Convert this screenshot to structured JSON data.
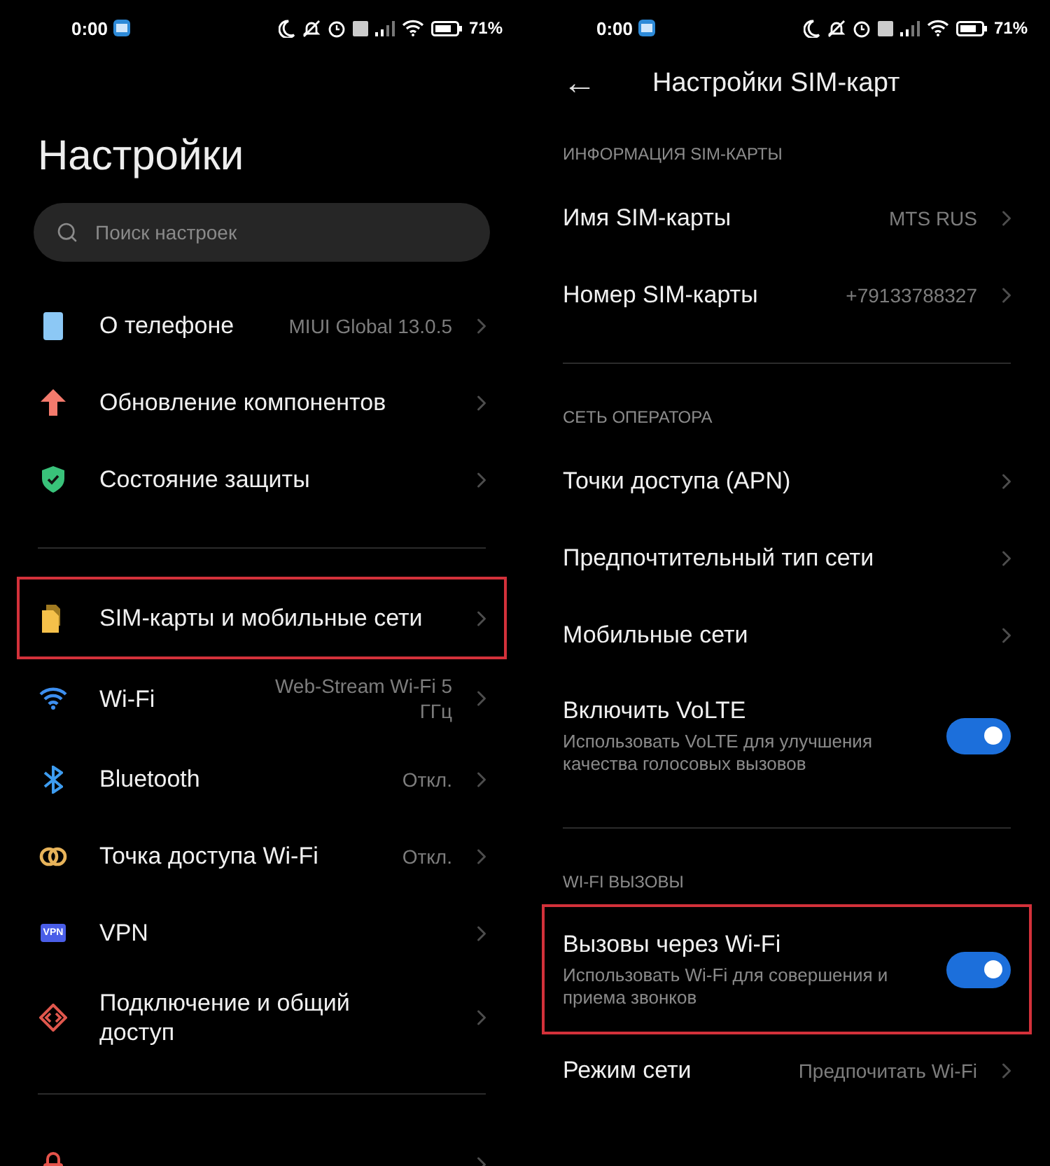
{
  "left_screen": {
    "status_bar": {
      "time": "0:00",
      "battery": "71%"
    },
    "title": "Настройки",
    "search": {
      "placeholder": "Поиск настроек"
    },
    "groups": [
      {
        "items": [
          {
            "kind": "phone",
            "label": "О телефоне",
            "value": "MIUI Global 13.0.5",
            "highlighted": false
          },
          {
            "kind": "update",
            "label": "Обновление компонентов",
            "highlighted": false
          },
          {
            "kind": "shield",
            "label": "Состояние защиты",
            "highlighted": false
          }
        ]
      },
      {
        "items": [
          {
            "kind": "sim",
            "label": "SIM-карты и мобильные сети",
            "highlighted": true
          },
          {
            "kind": "wifi",
            "label": "Wi-Fi",
            "value": "Web-Stream Wi-Fi 5 ГГц",
            "highlighted": false
          },
          {
            "kind": "bluetooth",
            "label": "Bluetooth",
            "value": "Откл.",
            "highlighted": false
          },
          {
            "kind": "hotspot",
            "label": "Точка доступа Wi-Fi",
            "value": "Откл.",
            "highlighted": false
          },
          {
            "kind": "vpn",
            "icon_text": "VPN",
            "label": "VPN",
            "highlighted": false
          },
          {
            "kind": "share",
            "label": "Подключение и общий доступ",
            "highlighted": false
          }
        ]
      },
      {
        "items": [
          {
            "kind": "lock",
            "highlighted": false
          }
        ]
      }
    ]
  },
  "right_screen": {
    "status_bar": {
      "time": "0:00",
      "battery": "71%"
    },
    "header": {
      "back": "←",
      "title": "Настройки SIM-карт"
    },
    "sections": [
      {
        "heading": "ИНФОРМАЦИЯ SIM-КАРТЫ",
        "items": [
          {
            "kind": "nav",
            "label": "Имя SIM-карты",
            "value": "MTS RUS",
            "highlighted": false
          },
          {
            "kind": "nav",
            "label": "Номер SIM-карты",
            "value": "+79133788327",
            "highlighted": false
          }
        ]
      },
      {
        "heading": "СЕТЬ ОПЕРАТОРА",
        "items": [
          {
            "kind": "nav",
            "label": "Точки доступа (APN)",
            "highlighted": false
          },
          {
            "kind": "nav",
            "label": "Предпочтительный тип сети",
            "highlighted": false
          },
          {
            "kind": "nav",
            "label": "Мобильные сети",
            "highlighted": false
          },
          {
            "kind": "toggle",
            "label": "Включить VoLTE",
            "description": "Использовать VoLTE для улучшения качества голосовых вызовов",
            "on": true,
            "highlighted": false
          }
        ]
      },
      {
        "heading": "WI-FI ВЫЗОВЫ",
        "items": [
          {
            "kind": "toggle",
            "label": "Вызовы через Wi-Fi",
            "description": "Использовать Wi-Fi для совершения и приема звонков",
            "on": true,
            "highlighted": true
          },
          {
            "kind": "nav",
            "label": "Режим сети",
            "value": "Предпочитать Wi-Fi",
            "highlighted": false
          }
        ]
      }
    ]
  }
}
